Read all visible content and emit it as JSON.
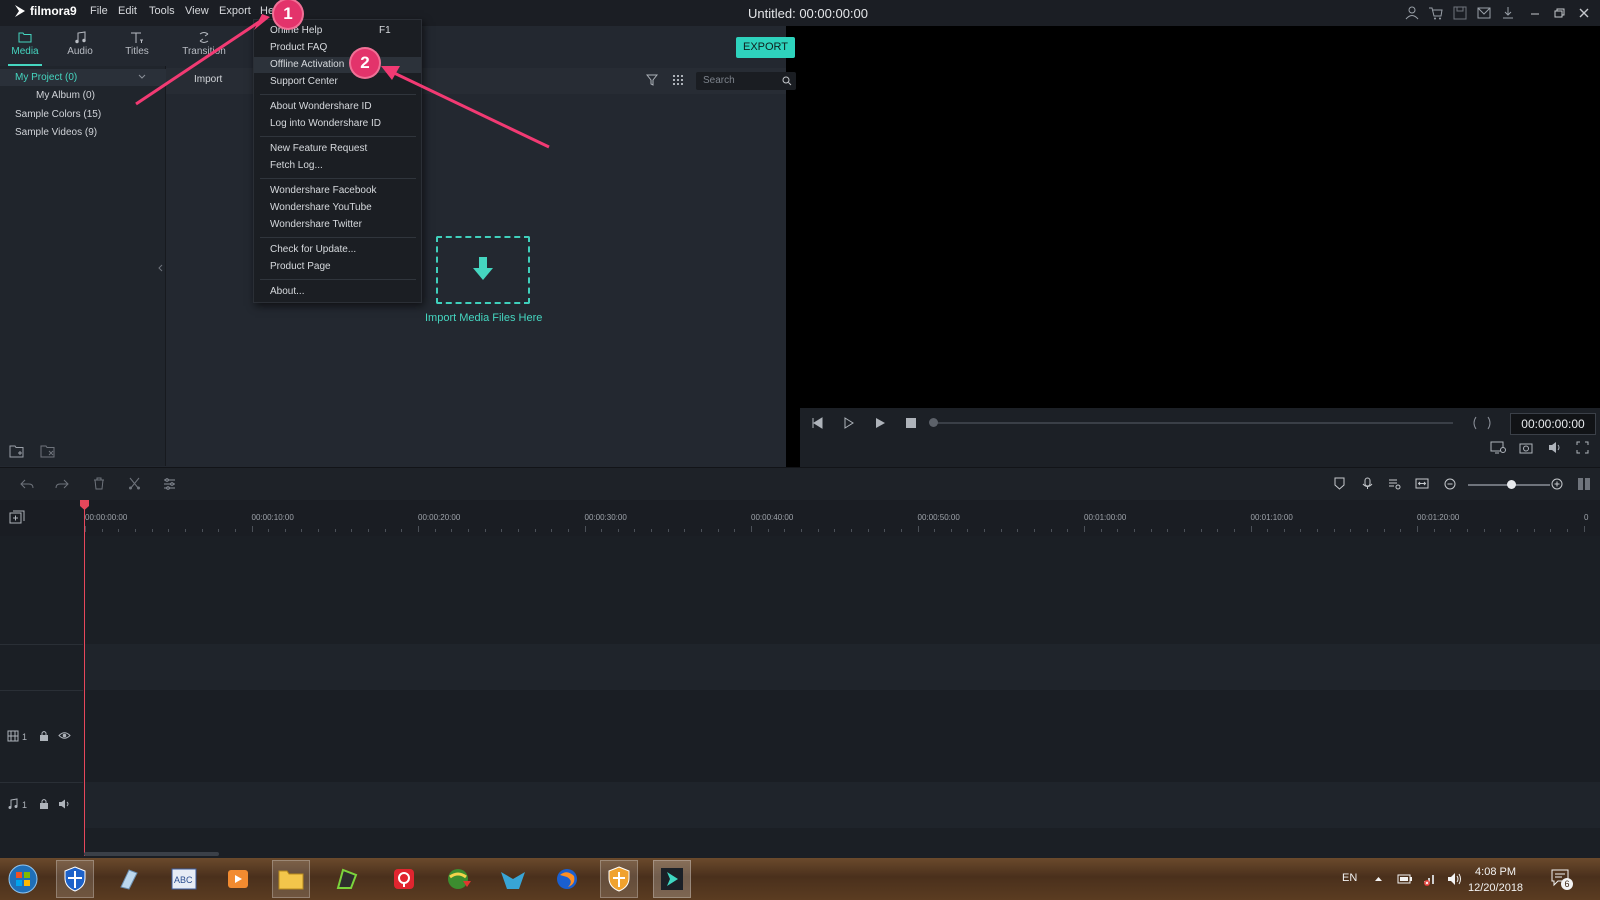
{
  "app": {
    "name": "filmora9",
    "title": "Untitled:",
    "title_time": "00:00:00:00"
  },
  "menubar": [
    "File",
    "Edit",
    "Tools",
    "View",
    "Export",
    "Help"
  ],
  "tabs": [
    {
      "label": "Media",
      "icon": "folder-icon",
      "active": true
    },
    {
      "label": "Audio",
      "icon": "music-note-icon"
    },
    {
      "label": "Titles",
      "icon": "text-icon"
    },
    {
      "label": "Transition",
      "icon": "transition-icon"
    }
  ],
  "export_label": "EXPORT",
  "library": {
    "items": [
      {
        "label": "My Project (0)",
        "selected": true
      },
      {
        "label": "My Album (0)"
      },
      {
        "label": "Sample Colors (15)"
      },
      {
        "label": "Sample Videos (9)"
      }
    ],
    "import_label": "Import",
    "search_placeholder": "Search",
    "import_hint": "Import Media Files Here"
  },
  "help_menu": {
    "items": [
      {
        "label": "Online Help",
        "shortcut": "F1"
      },
      {
        "label": "Product FAQ"
      },
      {
        "label": "Offline Activation",
        "highlighted": true
      },
      {
        "label": "Support Center"
      },
      {
        "label": "About Wondershare ID"
      },
      {
        "label": "Log into Wondershare ID"
      },
      {
        "label": "New Feature Request"
      },
      {
        "label": "Fetch Log..."
      },
      {
        "label": "Wondershare Facebook"
      },
      {
        "label": "Wondershare YouTube"
      },
      {
        "label": "Wondershare Twitter"
      },
      {
        "label": "Check for Update..."
      },
      {
        "label": "Product Page"
      },
      {
        "label": "About..."
      }
    ]
  },
  "player": {
    "timecode": "00:00:00:00"
  },
  "timeline": {
    "ruler": [
      "00:00:00:00",
      "00:00:10:00",
      "00:00:20:00",
      "00:00:30:00",
      "00:00:40:00",
      "00:00:50:00",
      "00:01:00:00",
      "00:01:10:00",
      "00:01:20:00",
      "0"
    ],
    "video_track": "1",
    "audio_track": "1"
  },
  "annotations": [
    "1",
    "2"
  ],
  "taskbar": {
    "language": "EN",
    "time": "4:08 PM",
    "date": "12/20/2018",
    "notifications": "6"
  },
  "colors": {
    "accent": "#2ed3bd",
    "annotation": "#e3336b",
    "playhead": "#e6475b"
  }
}
